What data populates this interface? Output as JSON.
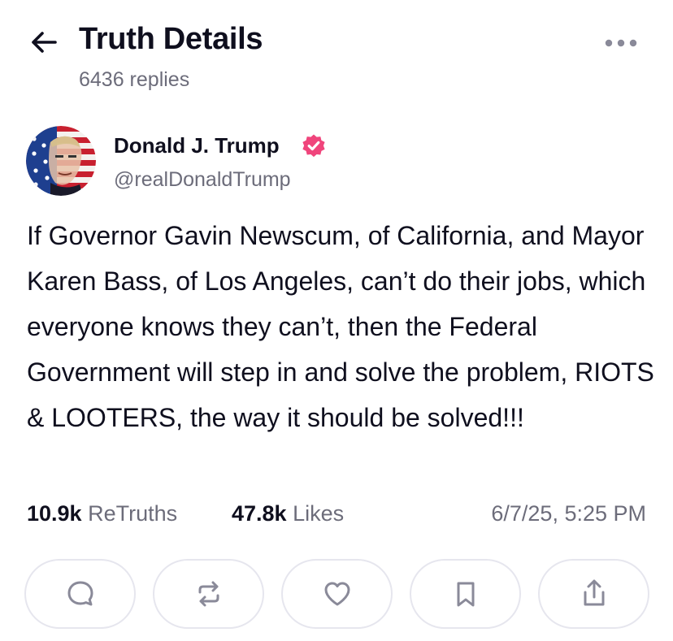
{
  "header": {
    "title": "Truth Details",
    "replies": "6436 replies",
    "back_icon": "arrow-left-icon",
    "more_icon": "more-horizontal-icon"
  },
  "post": {
    "author_name": "Donald J. Trump",
    "handle": "@realDonaldTrump",
    "verified": true,
    "verified_color": "#f0457c",
    "text": "If Governor Gavin Newscum, of California, and Mayor Karen Bass, of Los Angeles, can’t do their jobs, which everyone knows they can’t, then the Federal Government will step in and solve the problem, RIOTS & LOOTERS, the way it should be solved!!!",
    "retruths_count": "10.9k",
    "retruths_label": "ReTruths",
    "likes_count": "47.8k",
    "likes_label": "Likes",
    "timestamp": "6/7/25, 5:25 PM"
  },
  "actions": [
    {
      "name": "reply-button",
      "icon": "reply-bubble-icon"
    },
    {
      "name": "retruth-button",
      "icon": "retruth-icon"
    },
    {
      "name": "like-button",
      "icon": "heart-icon"
    },
    {
      "name": "bookmark-button",
      "icon": "bookmark-icon"
    },
    {
      "name": "share-button",
      "icon": "share-icon"
    }
  ],
  "colors": {
    "text_primary": "#0f0f1e",
    "text_secondary": "#6c6c7a",
    "icon_gray": "#8a8a99",
    "border": "#e6e6ee"
  }
}
